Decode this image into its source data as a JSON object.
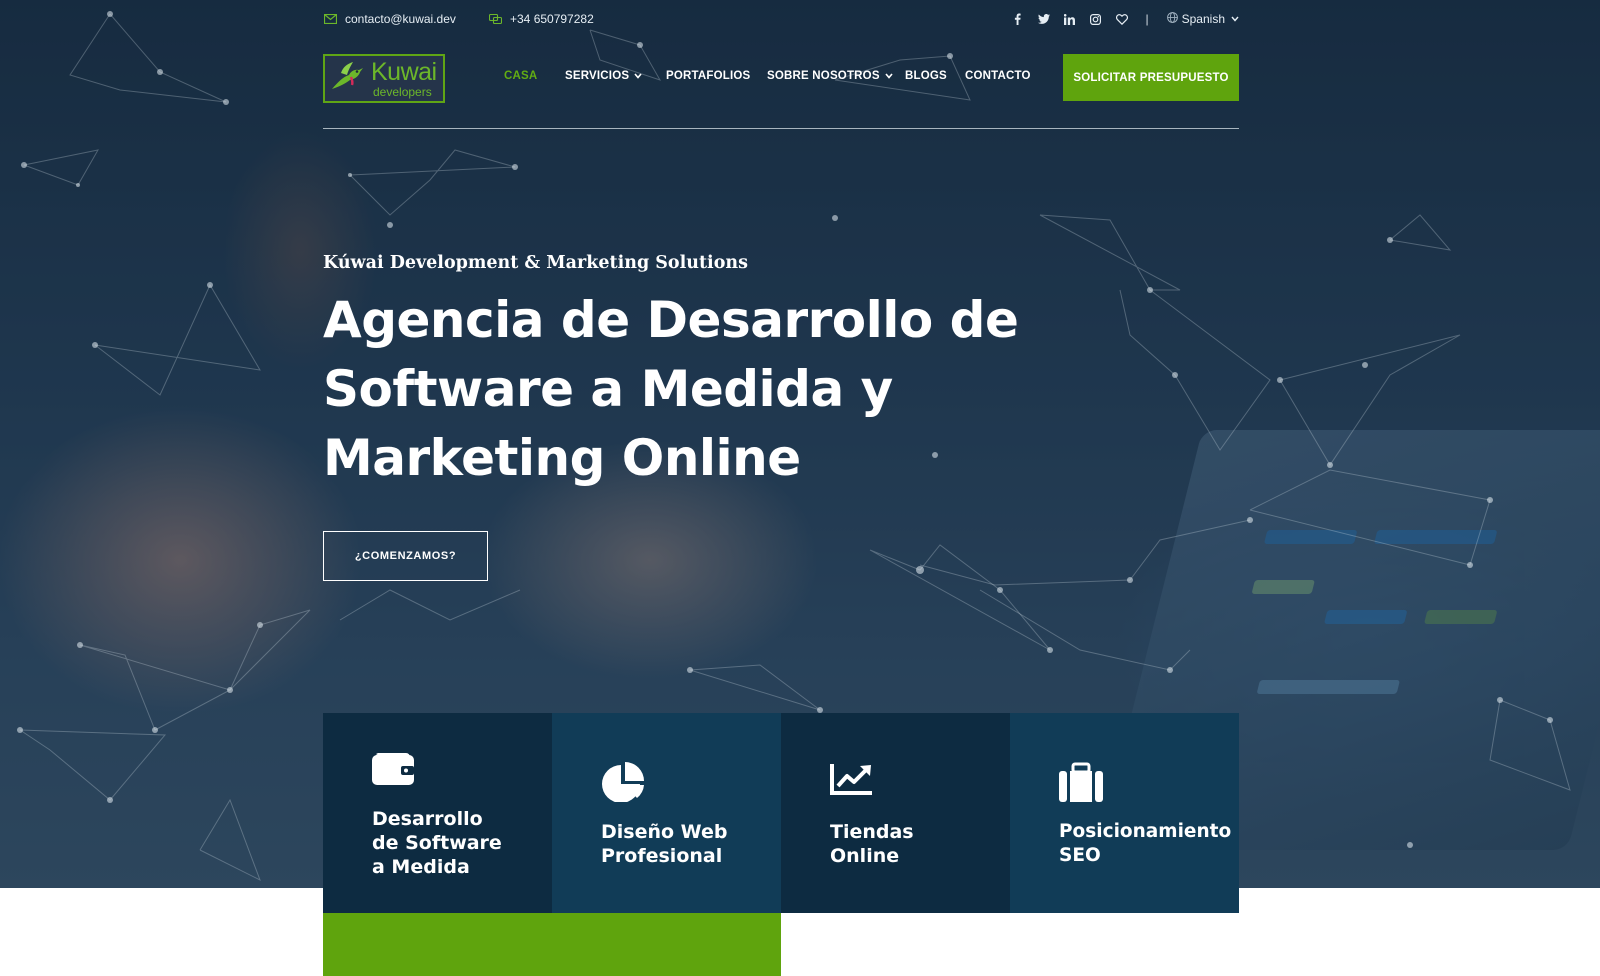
{
  "topbar": {
    "email": "contacto@kuwai.dev",
    "phone": "+34 650797282",
    "language": "Spanish",
    "separator": "|"
  },
  "logo": {
    "name": "Kuwai",
    "subtitle": "developers"
  },
  "nav": {
    "items": [
      {
        "label": "CASA",
        "active": true,
        "dropdown": false
      },
      {
        "label": "SERVICIOS",
        "active": false,
        "dropdown": true
      },
      {
        "label": "PORTAFOLIOS",
        "active": false,
        "dropdown": false
      },
      {
        "label": "SOBRE NOSOTROS",
        "active": false,
        "dropdown": true
      },
      {
        "label": "BLOGS",
        "active": false,
        "dropdown": false
      },
      {
        "label": "CONTACTO",
        "active": false,
        "dropdown": false
      }
    ],
    "cta_label": "SOLICITAR PRESUPUESTO"
  },
  "hero": {
    "subtitle": "Kúwai Development & Marketing Solutions",
    "title_lines": [
      "Agencia de Desarrollo de",
      "Software a Medida y",
      "Marketing Online"
    ],
    "cta_label": "¿COMENZAMOS?"
  },
  "services": [
    {
      "icon": "wallet-icon",
      "lines": [
        "Desarrollo",
        "de Software",
        "a Medida"
      ]
    },
    {
      "icon": "pie-chart-icon",
      "lines": [
        "Diseño Web",
        "Profesional"
      ]
    },
    {
      "icon": "chart-line-icon",
      "lines": [
        "Tiendas",
        "Online"
      ]
    },
    {
      "icon": "suitcase-icon",
      "lines": [
        "Posicionamiento",
        "SEO"
      ]
    }
  ],
  "colors": {
    "accent_green": "#5fa40d",
    "active_nav": "#62ad13",
    "card_dark": "#0d2b41",
    "card_light": "#113c57"
  }
}
